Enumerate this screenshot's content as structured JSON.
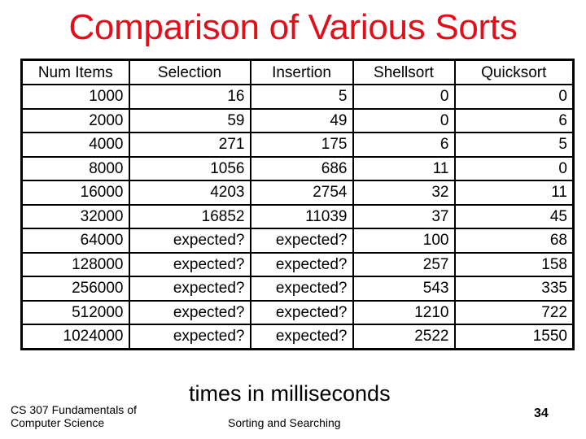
{
  "slide": {
    "title": "Comparison of Various Sorts",
    "note": "times in milliseconds",
    "footer_left_line1": "CS 307 Fundamentals of",
    "footer_left_line2": "Computer Science",
    "footer_center": "Sorting and Searching",
    "page_number": "34",
    "title_color": "#e0101a"
  },
  "table": {
    "headers": [
      "Num Items",
      "Selection",
      "Insertion",
      "Shellsort",
      "Quicksort"
    ],
    "rows": [
      [
        "1000",
        "16",
        "5",
        "0",
        "0"
      ],
      [
        "2000",
        "59",
        "49",
        "0",
        "6"
      ],
      [
        "4000",
        "271",
        "175",
        "6",
        "5"
      ],
      [
        "8000",
        "1056",
        "686",
        "11",
        "0"
      ],
      [
        "16000",
        "4203",
        "2754",
        "32",
        "11"
      ],
      [
        "32000",
        "16852",
        "11039",
        "37",
        "45"
      ],
      [
        "64000",
        "expected?",
        "expected?",
        "100",
        "68"
      ],
      [
        "128000",
        "expected?",
        "expected?",
        "257",
        "158"
      ],
      [
        "256000",
        "expected?",
        "expected?",
        "543",
        "335"
      ],
      [
        "512000",
        "expected?",
        "expected?",
        "1210",
        "722"
      ],
      [
        "1024000",
        "expected?",
        "expected?",
        "2522",
        "1550"
      ]
    ]
  }
}
